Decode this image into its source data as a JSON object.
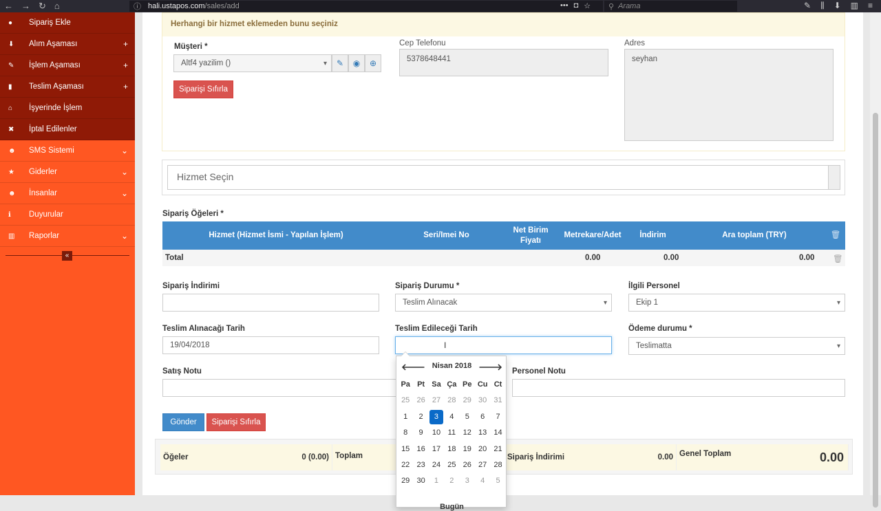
{
  "browser": {
    "url_host": "hali.ustapos.com",
    "url_path": "/sales/add",
    "search_placeholder": "Arama"
  },
  "sidebar": {
    "items": [
      {
        "label": "Sipariş Ekle",
        "icon": "plus-circle-icon",
        "glyph": "●",
        "right": ""
      },
      {
        "label": "Alım Aşaması",
        "icon": "arrow-down-icon",
        "glyph": "⬇",
        "right": "+"
      },
      {
        "label": "İşlem Aşaması",
        "icon": "pencil-icon",
        "glyph": "✎",
        "right": "+"
      },
      {
        "label": "Teslim Aşaması",
        "icon": "truck-icon",
        "glyph": "▮",
        "right": "+"
      },
      {
        "label": "İşyerinde İşlem",
        "icon": "home-icon",
        "glyph": "⌂",
        "right": ""
      },
      {
        "label": "İptal Edilenler",
        "icon": "times-icon",
        "glyph": "✖",
        "right": ""
      },
      {
        "label": "SMS Sistemi",
        "icon": "users-icon",
        "glyph": "☻",
        "right": "⌄"
      },
      {
        "label": "Giderler",
        "icon": "star-icon",
        "glyph": "★",
        "right": "⌄"
      },
      {
        "label": "İnsanlar",
        "icon": "users-icon",
        "glyph": "☻",
        "right": "⌄"
      },
      {
        "label": "Duyurular",
        "icon": "info-icon",
        "glyph": "ℹ",
        "right": ""
      },
      {
        "label": "Raporlar",
        "icon": "bar-chart-icon",
        "glyph": "▥",
        "right": "⌄"
      }
    ],
    "collapse_glyph": "«"
  },
  "form": {
    "warning": "Herhangi bir hizmet eklemeden bunu seçiniz",
    "customer_label": "Müşteri *",
    "customer_value": "Altf4 yazilim ()",
    "reset_button": "Siparişi Sıfırla",
    "phone_label": "Cep Telefonu",
    "phone_value": "5378648441",
    "address_label": "Adres",
    "address_value": "seyhan",
    "service_placeholder": "Hizmet Seçin",
    "items_label": "Sipariş Öğeleri *",
    "discount_label": "Sipariş İndirimi",
    "discount_value": "",
    "status_label": "Sipariş Durumu *",
    "status_value": "Teslim Alınacak",
    "staff_label": "İlgili Personel",
    "staff_value": "Ekip 1",
    "pickup_label": "Teslim Alınacağı Tarih",
    "pickup_value": "19/04/2018",
    "delivery_label": "Teslim Edileceği Tarih",
    "delivery_value": "",
    "payment_label": "Ödeme durumu *",
    "payment_value": "Teslimatta",
    "sales_note_label": "Satış Notu",
    "staff_note_label": "Personel Notu",
    "submit_button": "Gönder",
    "reset_button2": "Siparişi Sıfırla"
  },
  "table": {
    "headers": [
      "Hizmet (Hizmet İsmi - Yapılan İşlem)",
      "Seri/Imei No",
      "Net Birim Fiyatı",
      "Metrekare/Adet",
      "İndirim",
      "Ara toplam (TRY)"
    ],
    "total_label": "Total",
    "total_qty": "0.00",
    "total_discount": "0.00",
    "total_subtotal": "0.00"
  },
  "summary": {
    "items_label": "Öğeler",
    "items_value": "0 (0.00)",
    "total_label": "Toplam",
    "discount_label": "Sipariş İndirimi",
    "discount_value": "0.00",
    "grand_label": "Genel Toplam",
    "grand_value": "0.00"
  },
  "datepicker": {
    "title": "Nisan 2018",
    "prev": "🡐",
    "next": "🡒",
    "dow": [
      "Pa",
      "Pt",
      "Sa",
      "Ça",
      "Pe",
      "Cu",
      "Ct"
    ],
    "today_label": "Bugün",
    "days": [
      {
        "d": "25",
        "old": true
      },
      {
        "d": "26",
        "old": true
      },
      {
        "d": "27",
        "old": true
      },
      {
        "d": "28",
        "old": true
      },
      {
        "d": "29",
        "old": true
      },
      {
        "d": "30",
        "old": true
      },
      {
        "d": "31",
        "old": true
      },
      {
        "d": "1"
      },
      {
        "d": "2"
      },
      {
        "d": "3",
        "active": true
      },
      {
        "d": "4"
      },
      {
        "d": "5"
      },
      {
        "d": "6"
      },
      {
        "d": "7"
      },
      {
        "d": "8"
      },
      {
        "d": "9"
      },
      {
        "d": "10"
      },
      {
        "d": "11"
      },
      {
        "d": "12"
      },
      {
        "d": "13"
      },
      {
        "d": "14"
      },
      {
        "d": "15"
      },
      {
        "d": "16"
      },
      {
        "d": "17"
      },
      {
        "d": "18"
      },
      {
        "d": "19"
      },
      {
        "d": "20"
      },
      {
        "d": "21"
      },
      {
        "d": "22"
      },
      {
        "d": "23"
      },
      {
        "d": "24"
      },
      {
        "d": "25"
      },
      {
        "d": "26"
      },
      {
        "d": "27"
      },
      {
        "d": "28"
      },
      {
        "d": "29"
      },
      {
        "d": "30"
      },
      {
        "d": "1",
        "old": true
      },
      {
        "d": "2",
        "old": true
      },
      {
        "d": "3",
        "old": true
      },
      {
        "d": "4",
        "old": true
      },
      {
        "d": "5",
        "old": true
      }
    ]
  }
}
